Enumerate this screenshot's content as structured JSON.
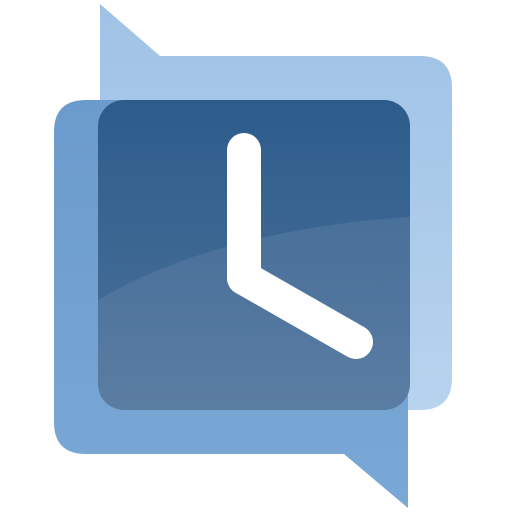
{
  "icon": {
    "name": "clock-chat-icon",
    "colors": {
      "back_bubble": "#a9c8e8",
      "back_bubble_edge": "#8fb6df",
      "front_bubble": "#6f9fcf",
      "front_bubble_edge": "#5f91c4",
      "clock_face_top": "#2f5f8f",
      "clock_face_bottom": "#4a6f99",
      "gloss": "#ffffff",
      "hands": "#ffffff"
    },
    "clock": {
      "hour_hand_angle_deg": 0,
      "minute_hand_angle_deg": 120
    }
  }
}
